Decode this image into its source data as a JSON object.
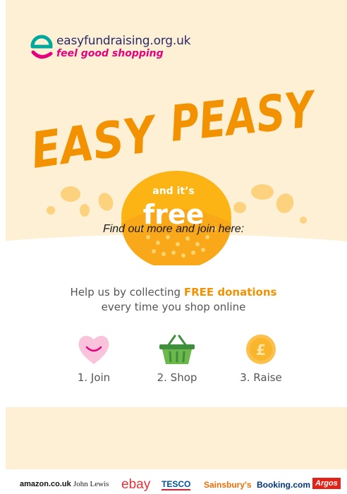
{
  "logo": {
    "url": "easyfundraising.org.uk",
    "tagline": "feel good shopping"
  },
  "headline": {
    "word1": "EASY",
    "word2": "PEASY"
  },
  "lemon": {
    "line1": "and it’s",
    "line2": "free"
  },
  "find_out": "Find out more and join here:",
  "help": {
    "prefix": "Help us by collecting ",
    "highlight": "FREE donations",
    "line2": "every time you shop online"
  },
  "steps": [
    {
      "label": "1. Join",
      "icon": "heart-icon"
    },
    {
      "label": "2. Shop",
      "icon": "basket-icon"
    },
    {
      "label": "3. Raise",
      "icon": "pound-coin-icon"
    }
  ],
  "brands": [
    "amazon.co.uk",
    "John Lewis",
    "ebay",
    "TESCO",
    "Sainsbury's",
    "Booking.com",
    "Argos"
  ],
  "colors": {
    "cream": "#fdf0d5",
    "orange": "#f39200",
    "pink": "#e6007e",
    "teal": "#00a99d",
    "lemon": "#fbb414"
  }
}
